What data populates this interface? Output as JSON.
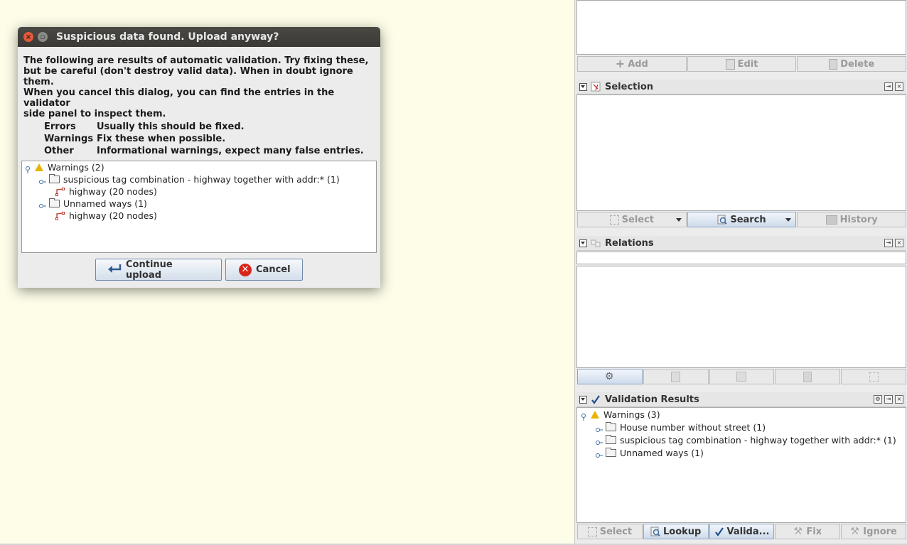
{
  "dialog": {
    "title": "Suspicious data found. Upload anyway?",
    "message_lines": [
      "The following are results of automatic validation. Try fixing these,",
      "but be careful (don't destroy valid data). When in doubt ignore them.",
      "When you cancel this dialog, you can find the entries in the validator",
      "side panel to inspect them."
    ],
    "legend": [
      {
        "key": "Errors",
        "desc": "Usually this should be fixed."
      },
      {
        "key": "Warnings",
        "desc": "Fix these when possible."
      },
      {
        "key": "Other",
        "desc": "Informational warnings, expect many false entries."
      }
    ],
    "tree": {
      "root": "Warnings (2)",
      "group1": "suspicious tag combination - highway together with addr:* (1)",
      "group1_item": "highway (20 nodes)",
      "group2": "Unnamed ways (1)",
      "group2_item": "highway (20 nodes)"
    },
    "continue_label": "Continue upload",
    "cancel_label": "Cancel"
  },
  "top_panel": {
    "buttons": [
      "Add",
      "Edit",
      "Delete"
    ]
  },
  "selection_panel": {
    "title": "Selection",
    "buttons": [
      "Select",
      "Search",
      "History"
    ]
  },
  "relations_panel": {
    "title": "Relations"
  },
  "validation_panel": {
    "title": "Validation Results",
    "tree": {
      "root": "Warnings (3)",
      "items": [
        "House number without street (1)",
        "suspicious tag combination - highway together with addr:* (1)",
        "Unnamed ways (1)"
      ]
    },
    "buttons": [
      "Select",
      "Lookup",
      "Valida...",
      "Fix",
      "Ignore"
    ]
  },
  "colors": {
    "map_background": "#fdfde8",
    "warning_icon": "#e8b400",
    "close_button": "#e25a3a",
    "way_icon": "#c0392b"
  }
}
